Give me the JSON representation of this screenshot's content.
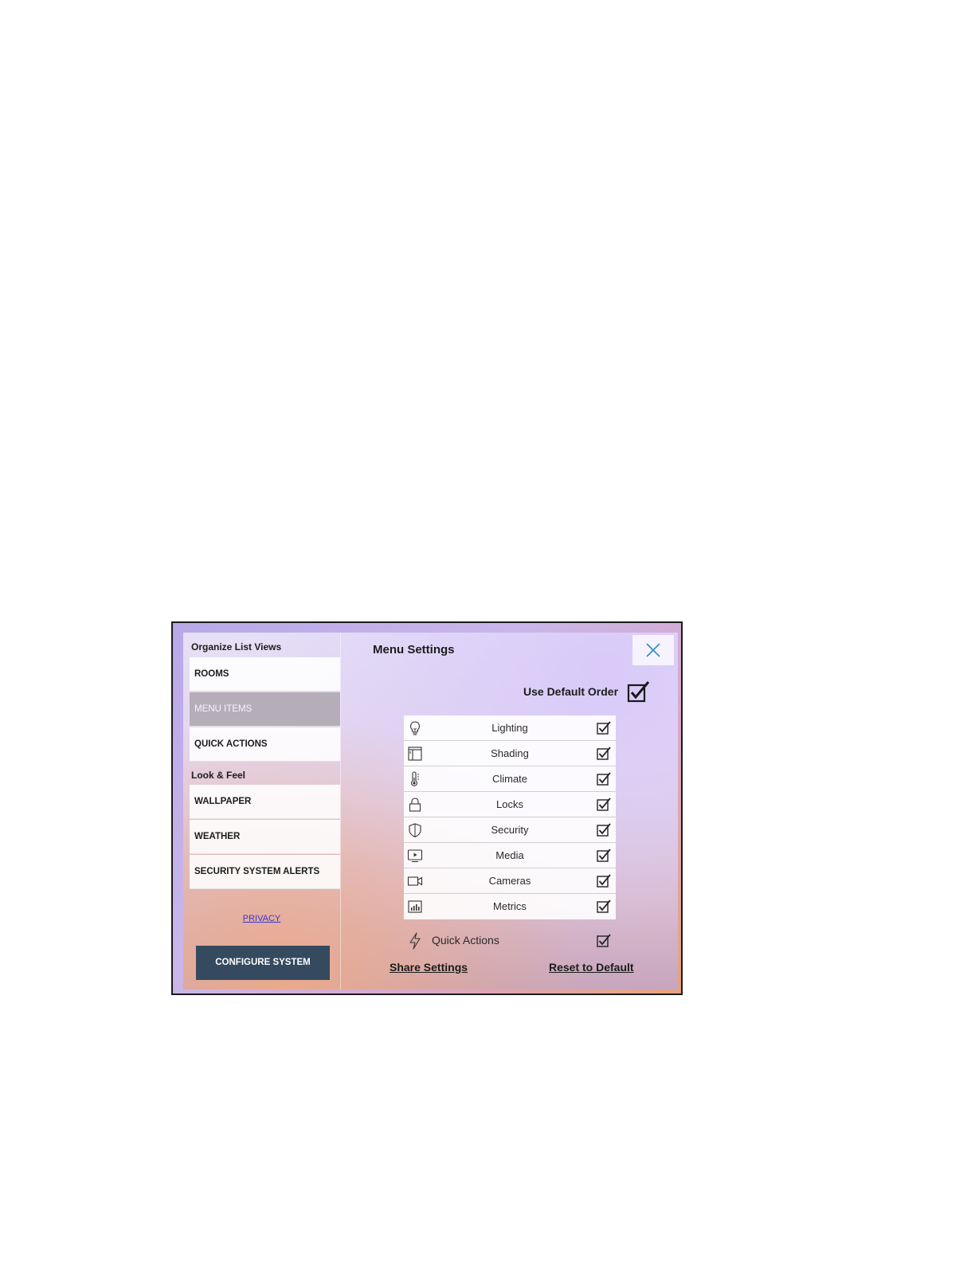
{
  "sidebar": {
    "section1_title": "Organize List Views",
    "section2_title": "Look & Feel",
    "items1": [
      {
        "label": "ROOMS"
      },
      {
        "label": "MENU ITEMS",
        "active": true
      },
      {
        "label": "QUICK ACTIONS"
      }
    ],
    "items2": [
      {
        "label": "WALLPAPER"
      },
      {
        "label": "WEATHER"
      },
      {
        "label": "SECURITY SYSTEM ALERTS"
      }
    ],
    "privacy": "PRIVACY",
    "configure": "CONFIGURE SYSTEM"
  },
  "main": {
    "title": "Menu Settings",
    "close_icon": "close-icon",
    "default_order_label": "Use Default Order",
    "default_order_checked": true,
    "menu_items": [
      {
        "label": "Lighting",
        "icon": "lightbulb-icon",
        "checked": true
      },
      {
        "label": "Shading",
        "icon": "shade-icon",
        "checked": true
      },
      {
        "label": "Climate",
        "icon": "thermometer-icon",
        "checked": true
      },
      {
        "label": "Locks",
        "icon": "lock-icon",
        "checked": true
      },
      {
        "label": "Security",
        "icon": "shield-icon",
        "checked": true
      },
      {
        "label": "Media",
        "icon": "media-icon",
        "checked": true
      },
      {
        "label": "Cameras",
        "icon": "camera-icon",
        "checked": true
      },
      {
        "label": "Metrics",
        "icon": "metrics-icon",
        "checked": true
      }
    ],
    "quick_actions": {
      "label": "Quick Actions",
      "icon": "lightning-icon",
      "checked": true
    },
    "share_settings": "Share Settings",
    "reset_default": "Reset to Default"
  },
  "colors": {
    "configure_bg": "#354a5f",
    "active_item_bg": "#b5aeb9",
    "privacy_link": "#3a35c8",
    "close_icon": "#2a8fc4"
  }
}
